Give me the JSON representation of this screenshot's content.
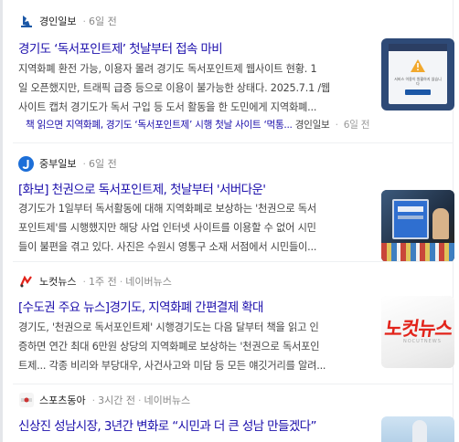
{
  "articles": [
    {
      "press": "경인일보",
      "time": "6일 전",
      "title": "경기도 ‘독서포인트제’ 첫날부터 접속 마비",
      "desc_lines": [
        "지역화폐 환전 가능, 이용자 몰려 경기도 독서포인트제 웹사이트 현황. 1",
        "일 오픈했지만, 트래픽 급증 등으로 이용이 불가능한 상태다. 2025.7.1 /웹",
        "사이트 캡처 경기도가 독서 구입 등 도서 활동을 한 도민에게 지역화폐..."
      ],
      "related_text": "책 읽으면 지역화폐, 경기도 ‘독서포인트제’ 시행 첫날 사이트 ‘먹통...",
      "related_press": "경인일보",
      "related_time": "6일 전"
    },
    {
      "press": "중부일보",
      "time": "6일 전",
      "title": "[화보] 천권으로 독서포인트제, 첫날부터 '서버다운'",
      "desc_lines": [
        "경기도가 1일부터 독서활동에 대해 지역화폐로 보상하는 '천권으로 독서",
        "포인트제'를 시행했지만 해당 사업 인터넷 사이트를 이용할 수 없어 시민",
        "들이 불편을 겪고 있다. 사진은 수원시 영통구 소재 서점에서 시민들이..."
      ]
    },
    {
      "press": "노컷뉴스",
      "time": "1주 전",
      "extra": "네이버뉴스",
      "title": "[수도권 주요 뉴스]경기도, 지역화폐 간편결제 확대",
      "desc_lines": [
        "경기도, '천권으로 독서포인트제' 시행경기도는 다음 달부터 책을 읽고 인",
        "증하면 연간 최대 6만원 상당의 지역화폐로 보상하는 '천권으로 독서포인",
        "트제... 각종 비리와 부당대우, 사건사고와 미담 등 모든 얘깃거리를 알려..."
      ],
      "thumb_text": "노컷뉴스",
      "thumb_sub": "NOCUTNEWS"
    },
    {
      "press": "스포츠동아",
      "time": "3시간 전",
      "extra": "네이버뉴스",
      "title": "신상진 성남시장, 3년간 변화로 “시민과 더 큰 성남 만들겠다”"
    }
  ],
  "thumb1": {
    "notice_text": "서비스 이용이 원활하지 않습니다"
  },
  "colors": {
    "title_link": "#1a0dab",
    "body_text": "#444444",
    "meta": "#888888",
    "nocut_red": "#e2231a"
  },
  "icons": [
    "kyeongin-logo-icon",
    "joongboo-logo-icon",
    "nocut-logo-icon",
    "sportsdonga-logo-icon",
    "warning-icon"
  ]
}
